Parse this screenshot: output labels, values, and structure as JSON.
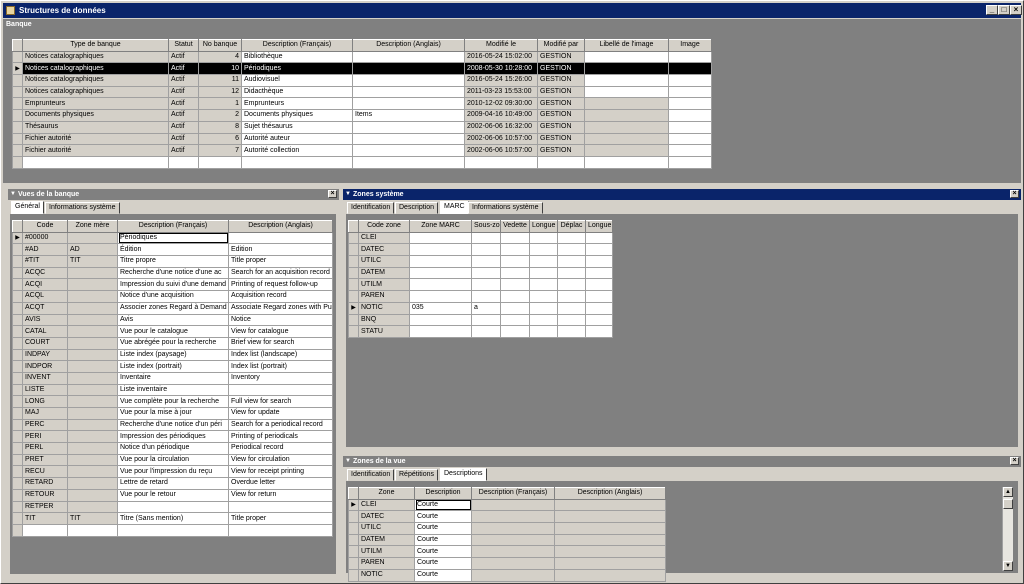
{
  "window": {
    "title": "Structures de données",
    "minimize": "_",
    "maximize": "□",
    "close": "×"
  },
  "banque": {
    "title": "Banque",
    "columns": [
      "Type de banque",
      "Statut",
      "No banque",
      "Description (Français)",
      "Description (Anglais)",
      "Modifié le",
      "Modifié par",
      "Libellé de l'image",
      "Image"
    ],
    "rows": [
      [
        "Notices catalographiques",
        "Actif",
        "4",
        "Bibliothèque",
        "",
        "2016-05-24 15:02:00",
        "GESTION",
        "",
        ""
      ],
      [
        "Notices catalographiques",
        "Actif",
        "10",
        "Périodiques",
        "",
        "2008-05-30 10:28:00",
        "GESTION",
        "",
        ""
      ],
      [
        "Notices catalographiques",
        "Actif",
        "11",
        "Audiovisuel",
        "",
        "2016-05-24 15:26:00",
        "GESTION",
        "",
        ""
      ],
      [
        "Notices catalographiques",
        "Actif",
        "12",
        "Didacthèque",
        "",
        "2011-03-23 15:53:00",
        "GESTION",
        "",
        ""
      ],
      [
        "Emprunteurs",
        "Actif",
        "1",
        "Emprunteurs",
        "",
        "2010-12-02 09:30:00",
        "GESTION",
        "",
        ""
      ],
      [
        "Documents physiques",
        "Actif",
        "2",
        "Documents physiques",
        "Items",
        "2009-04-16 10:49:00",
        "GESTION",
        "",
        ""
      ],
      [
        "Thésaurus",
        "Actif",
        "8",
        "Sujet thésaurus",
        "",
        "2002-06-06 16:32:00",
        "GESTION",
        "",
        ""
      ],
      [
        "Fichier autorité",
        "Actif",
        "6",
        "Autorité auteur",
        "",
        "2002-06-06 10:57:00",
        "GESTION",
        "",
        ""
      ],
      [
        "Fichier autorité",
        "Actif",
        "7",
        "Autorité collection",
        "",
        "2002-06-06 10:57:00",
        "GESTION",
        "",
        ""
      ]
    ]
  },
  "vues": {
    "title": "Vues de la banque",
    "tabs": [
      "Général",
      "Informations système"
    ],
    "columns": [
      "Code",
      "Zone mère",
      "Description (Français)",
      "Description (Anglais)"
    ],
    "rows": [
      [
        "#00000",
        "",
        "Périodiques",
        ""
      ],
      [
        "#AD",
        "AD",
        "Édition",
        "Edition"
      ],
      [
        "#TIT",
        "TIT",
        "Titre propre",
        "Title proper"
      ],
      [
        "ACQC",
        "",
        "Recherche d'une notice d'une ac",
        "Search for an acquisition record"
      ],
      [
        "ACQI",
        "",
        "Impression du suivi d'une demand",
        "Printing of request follow-up"
      ],
      [
        "ACQL",
        "",
        "Notice d'une acquisition",
        "Acquisition record"
      ],
      [
        "ACQT",
        "",
        "Associer zones Regard à Demand",
        "Associate Regard zones with Pur"
      ],
      [
        "AVIS",
        "",
        "Avis",
        "Notice"
      ],
      [
        "CATAL",
        "",
        "Vue pour le catalogue",
        "View for catalogue"
      ],
      [
        "COURT",
        "",
        "Vue abrégée pour la recherche",
        "Brief view for search"
      ],
      [
        "INDPAY",
        "",
        "Liste index (paysage)",
        "Index list (landscape)"
      ],
      [
        "INDPOR",
        "",
        "Liste index (portrait)",
        "Index list (portrait)"
      ],
      [
        "INVENT",
        "",
        "Inventaire",
        "Inventory"
      ],
      [
        "LISTE",
        "",
        "Liste inventaire",
        ""
      ],
      [
        "LONG",
        "",
        "Vue complète pour la recherche",
        "Full view for search"
      ],
      [
        "MAJ",
        "",
        "Vue pour la mise à jour",
        "View for update"
      ],
      [
        "PERC",
        "",
        "Recherche d'une notice d'un péri",
        "Search for a periodical record"
      ],
      [
        "PERI",
        "",
        "Impression des périodiques",
        "Printing of periodicals"
      ],
      [
        "PERL",
        "",
        "Notice d'un périodique",
        "Periodical record"
      ],
      [
        "PRET",
        "",
        "Vue pour la circulation",
        "View for circulation"
      ],
      [
        "RECU",
        "",
        "Vue pour l'impression du reçu",
        "View for receipt printing"
      ],
      [
        "RETARD",
        "",
        "Lettre de retard",
        "Overdue letter"
      ],
      [
        "RETOUR",
        "",
        "Vue pour le retour",
        "View for return"
      ],
      [
        "RETPER",
        "",
        "",
        ""
      ],
      [
        "TIT",
        "TIT",
        "Titre (Sans mention)",
        "Title proper"
      ]
    ]
  },
  "zones_systeme": {
    "title": "Zones système",
    "tabs": [
      "Identification",
      "Description",
      "MARC",
      "Informations système"
    ],
    "columns": [
      "Code zone",
      "Zone MARC",
      "Sous-zo",
      "Vedette",
      "Longue",
      "Déplac",
      "Longue"
    ],
    "rows": [
      [
        "CLEI",
        "",
        "",
        "",
        "",
        "",
        ""
      ],
      [
        "DATEC",
        "",
        "",
        "",
        "",
        "",
        ""
      ],
      [
        "UTILC",
        "",
        "",
        "",
        "",
        "",
        ""
      ],
      [
        "DATEM",
        "",
        "",
        "",
        "",
        "",
        ""
      ],
      [
        "UTILM",
        "",
        "",
        "",
        "",
        "",
        ""
      ],
      [
        "PAREN",
        "",
        "",
        "",
        "",
        "",
        ""
      ],
      [
        "NOTIC",
        "035",
        "a",
        "",
        "",
        "",
        ""
      ],
      [
        "BNQ",
        "",
        "",
        "",
        "",
        "",
        ""
      ],
      [
        "STATU",
        "",
        "",
        "",
        "",
        "",
        ""
      ]
    ]
  },
  "zones_vue": {
    "title": "Zones de la vue",
    "tabs": [
      "Identification",
      "Répétitions",
      "Descriptions"
    ],
    "columns": [
      "Zone",
      "Description",
      "Description (Français)",
      "Description (Anglais)"
    ],
    "rows": [
      [
        "CLEI",
        "Courte",
        "",
        ""
      ],
      [
        "DATEC",
        "Courte",
        "",
        ""
      ],
      [
        "UTILC",
        "Courte",
        "",
        ""
      ],
      [
        "DATEM",
        "Courte",
        "",
        ""
      ],
      [
        "UTILM",
        "Courte",
        "",
        ""
      ],
      [
        "PAREN",
        "Courte",
        "",
        ""
      ],
      [
        "NOTIC",
        "Courte",
        "",
        ""
      ]
    ]
  },
  "icons": {
    "row_indicator": "▶",
    "close": "×",
    "pin": "▼",
    "scroll_up": "▲",
    "scroll_down": "▼"
  }
}
